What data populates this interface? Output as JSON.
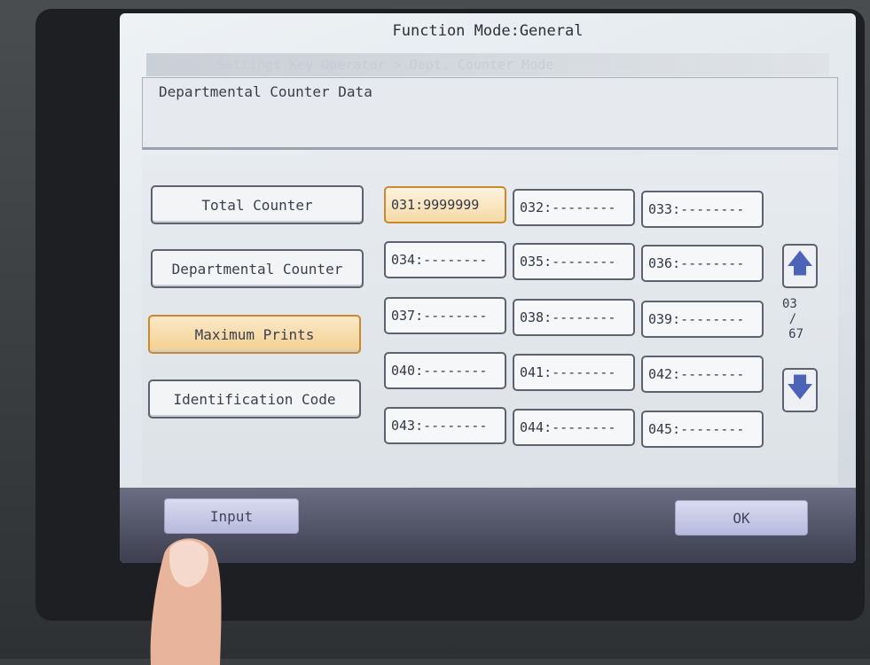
{
  "header": {
    "mode_title": "Function Mode:General",
    "breadcrumb": "Settings Key Operator > Dept. Counter Mode",
    "panel_title": "Departmental Counter Data"
  },
  "left_menu": [
    {
      "label": "Total Counter",
      "selected": false
    },
    {
      "label": "Departmental Counter",
      "selected": false
    },
    {
      "label": "Maximum Prints",
      "selected": true
    },
    {
      "label": "Identification Code",
      "selected": false
    }
  ],
  "grid": [
    {
      "label": "031:9999999",
      "selected": true
    },
    {
      "label": "032:--------",
      "selected": false
    },
    {
      "label": "033:--------",
      "selected": false
    },
    {
      "label": "034:--------",
      "selected": false
    },
    {
      "label": "035:--------",
      "selected": false
    },
    {
      "label": "036:--------",
      "selected": false
    },
    {
      "label": "037:--------",
      "selected": false
    },
    {
      "label": "038:--------",
      "selected": false
    },
    {
      "label": "039:--------",
      "selected": false
    },
    {
      "label": "040:--------",
      "selected": false
    },
    {
      "label": "041:--------",
      "selected": false
    },
    {
      "label": "042:--------",
      "selected": false
    },
    {
      "label": "043:--------",
      "selected": false
    },
    {
      "label": "044:--------",
      "selected": false
    },
    {
      "label": "045:--------",
      "selected": false
    }
  ],
  "pager": {
    "current": "03",
    "separator": "/",
    "total": "67",
    "up_icon": "arrow-up-icon",
    "down_icon": "arrow-down-icon"
  },
  "footer": {
    "input_label": "Input",
    "ok_label": "OK"
  },
  "colors": {
    "accent": "#f4cf8f",
    "arrow": "#4c64b8",
    "footer": "#3d3f50"
  }
}
